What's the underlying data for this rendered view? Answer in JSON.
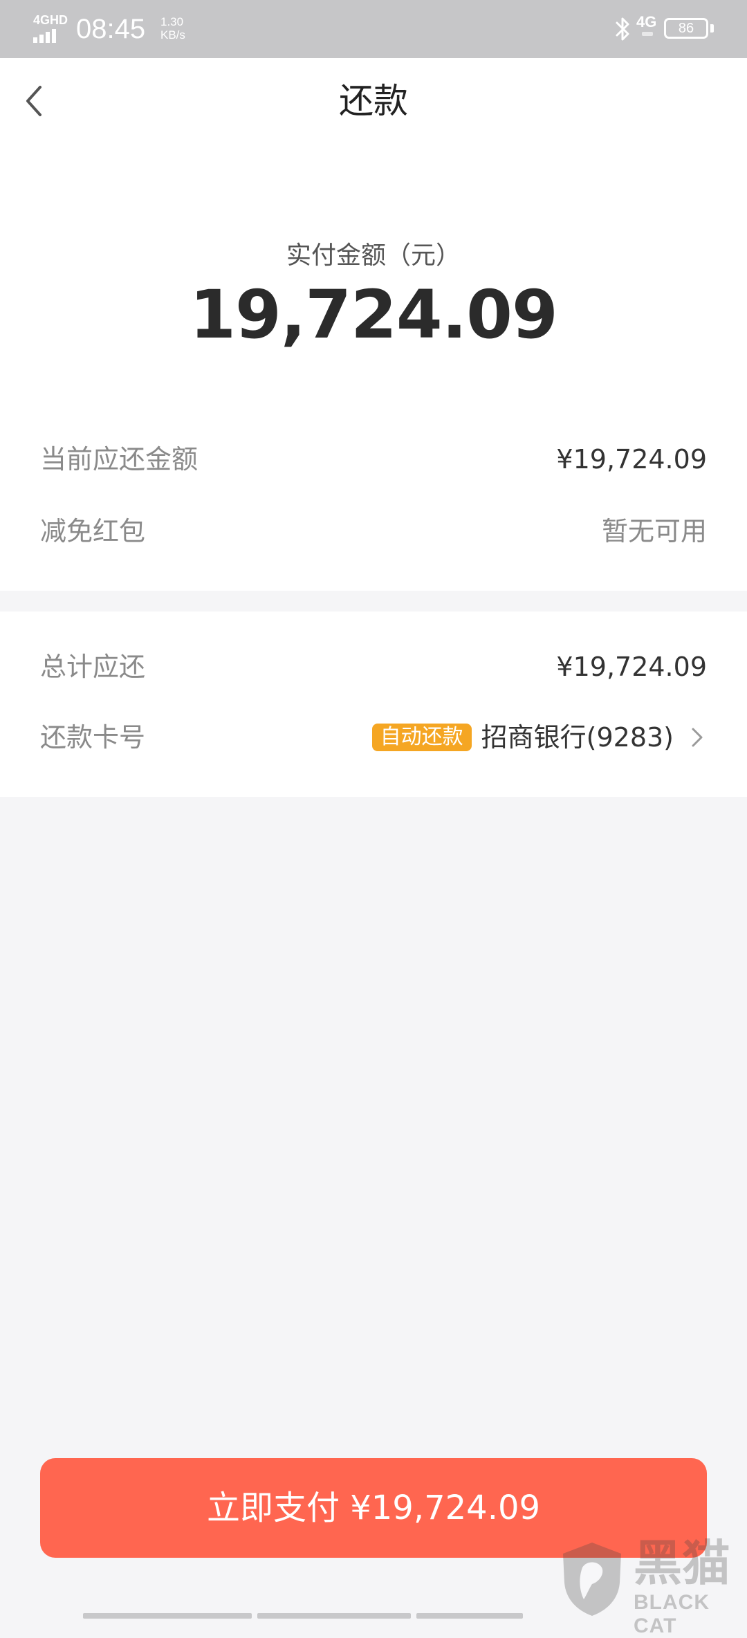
{
  "status_bar": {
    "network_label": "4GHD",
    "time": "08:45",
    "speed_value": "1.30",
    "speed_unit": "KB/s",
    "signal_4g": "4G",
    "battery": "86"
  },
  "header": {
    "title": "还款"
  },
  "summary": {
    "amount_label": "实付金额（元）",
    "amount_value": "19,724.09",
    "rows": [
      {
        "label": "当前应还金额",
        "value": "¥19,724.09"
      },
      {
        "label": "减免红包",
        "value": "暂无可用"
      }
    ]
  },
  "repay": {
    "total_label": "总计应还",
    "total_value": "¥19,724.09",
    "card_label": "还款卡号",
    "auto_badge": "自动还款",
    "bank": "招商银行(9283)"
  },
  "pay_button": {
    "label": "立即支付 ¥19,724.09"
  },
  "watermark": {
    "text": "黑猫",
    "sub": "BLACK CAT"
  },
  "colors": {
    "accent": "#ff6650",
    "badge": "#f5a623",
    "status_bar": "#c6c6c8",
    "background": "#f5f5f7"
  },
  "icons": {
    "back": "chevron-left-icon",
    "bank_arrow": "chevron-right-icon",
    "bluetooth": "bluetooth-icon",
    "battery": "battery-icon",
    "signal": "signal-icon"
  }
}
